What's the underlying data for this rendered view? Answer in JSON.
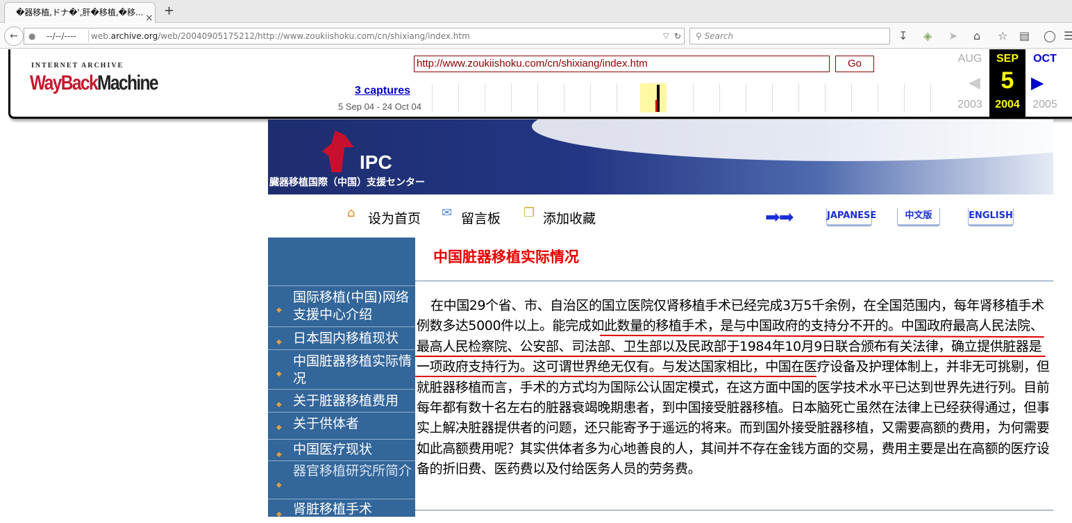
{
  "browser": {
    "tab_title": "�器移植,ドナ�',肝�移植,�移...",
    "tab_close": "×",
    "new_tab": "+",
    "url_date": "--/--/----",
    "url_prefix": "web.",
    "url_domain": "archive.org",
    "url_rest": "/web/20040905175212/http://www.zoukiishoku.com/cn/shixiang/index.htm",
    "search_placeholder": "Search"
  },
  "wayback": {
    "ia_label": "INTERNET ARCHIVE",
    "logo_way": "Way",
    "logo_back": "Back",
    "logo_machine": "Machine",
    "url_input": "http://www.zoukiishoku.com/cn/shixiang/index.htm",
    "go_label": "Go",
    "captures_label": "3 captures",
    "captures_span": "5 Sep 04 - 24 Oct 04",
    "prev_month": "AUG",
    "cur_month": "SEP",
    "next_month": "OCT",
    "cur_day": "5",
    "prev_year": "2003",
    "cur_year": "2004",
    "next_year": "2005"
  },
  "site": {
    "logo_text": "IPC",
    "logo_subtitle": "臓器移植国際（中国）支援センター",
    "nav": {
      "home": "设为首页",
      "guestbook": "留言板",
      "favorite": "添加收藏"
    },
    "lang": {
      "japanese": "JAPANESE",
      "chinese": "中文版",
      "english": "ENGLISH"
    },
    "sidebar": [
      "国际移植(中国)网络支援中心介绍",
      "日本国内移植现状",
      "中国脏器移植实际情况",
      "关于脏器移植费用",
      "关于供体者",
      "中国医疗现状",
      "器官移植研究所简介",
      "肾脏移植手术"
    ],
    "page_title": "中国脏器移植实际情况",
    "body_text": "在中国29个省、市、自治区的国立医院仅肾移植手术已经完成3万5千余例，在全国范围内，每年肾移植手术例数多达5000件以上。能完成如此数量的移植手术，是与中国政府的支持分不开的。中国政府最高人民法院、最高人民检察院、公安部、司法部、卫生部以及民政部于1984年10月9日联合颁布有关法律，确立提供脏器是一项政府支持行为。这可谓世界绝无仅有。与发达国家相比，中国在医疗设备及护理体制上，并非无可挑剔，但就脏器移植而言，手术的方式均为国际公认固定模式，在这方面中国的医学技术水平已达到世界先进行列。目前每年都有数十名左右的脏器衰竭晚期患者，到中国接受脏器移植。日本脑死亡虽然在法律上已经获得通过，但事实上解决脏器提供者的问题，还只能寄予于遥远的将来。而到国外接受脏器移植，又需要高额的费用，为何需要如此高额费用呢？其实供体者多为心地善良的人，其间并不存在金钱方面的交易，费用主要是出在高额的医疗设备的折旧费、医药费以及付给医务人员的劳务费。"
  },
  "colors": {
    "sidebar_bg": "#33669a",
    "title_red": "#e60000",
    "underline_red": "#e00000",
    "wayback_red": "#c5192d"
  }
}
